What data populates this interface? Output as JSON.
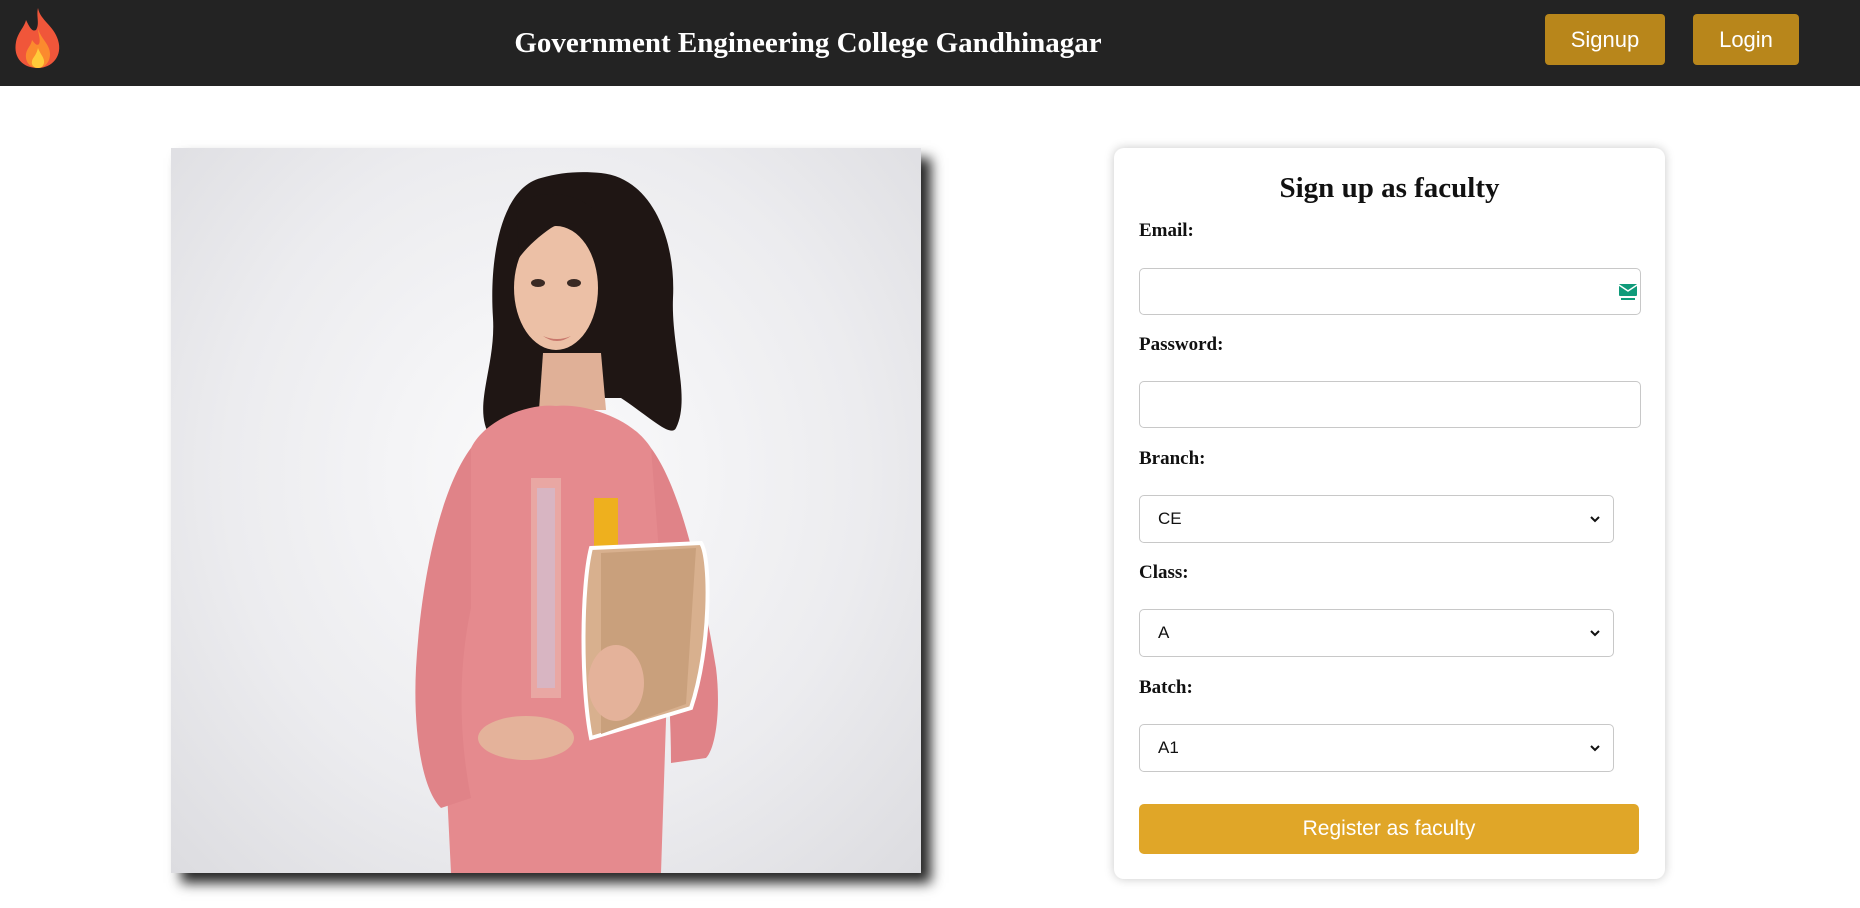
{
  "header": {
    "title": "Government Engineering College Gandhinagar",
    "signup_label": "Signup",
    "login_label": "Login",
    "logo_icon": "flame-icon"
  },
  "form": {
    "title": "Sign up as faculty",
    "email_label": "Email:",
    "email_value": "",
    "password_label": "Password:",
    "password_value": "",
    "branch_label": "Branch:",
    "branch_value": "CE",
    "class_label": "Class:",
    "class_value": "A",
    "batch_label": "Batch:",
    "batch_value": "A1",
    "submit_label": "Register as faculty"
  },
  "colors": {
    "topbar": "#232323",
    "nav_button": "#b8861b",
    "submit_button": "#e0a628"
  }
}
